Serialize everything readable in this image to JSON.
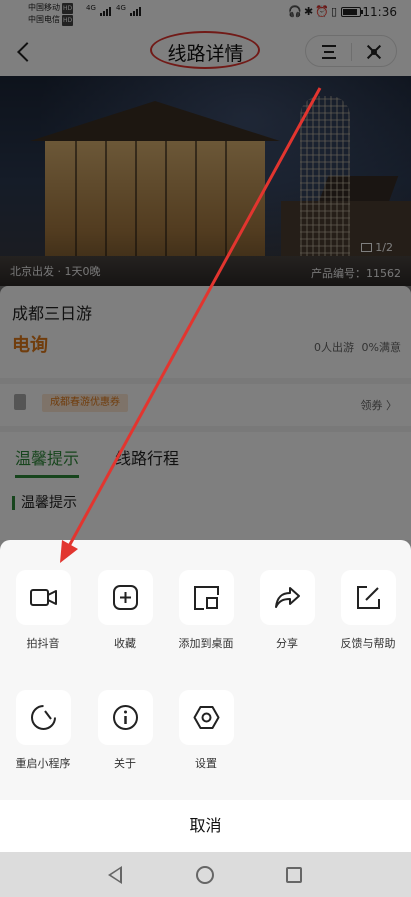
{
  "status_bar": {
    "carrier_1": "中国移动",
    "carrier_2": "中国电信",
    "hd_badge": "HD",
    "network_1": "4G",
    "network_2": "4G",
    "time": "11:36"
  },
  "navbar": {
    "title": "线路详情"
  },
  "hero": {
    "departure_info": "北京出发 · 1天0晚",
    "image_counter": "1/2",
    "product_code": "产品编号：11562"
  },
  "product": {
    "name": "成都三日游",
    "price": "电询",
    "stats": "0人出游 0%满意"
  },
  "coupon": {
    "tag": "成都春游优惠券",
    "get_label": "领券 〉"
  },
  "tabs": [
    {
      "label": "温馨提示"
    },
    {
      "label": "线路行程"
    }
  ],
  "section": {
    "title": "温馨提示"
  },
  "action_sheet": {
    "row1": [
      {
        "label": "拍抖音",
        "icon": "video-camera-icon"
      },
      {
        "label": "收藏",
        "icon": "add-favorite-icon"
      },
      {
        "label": "添加到桌面",
        "icon": "add-to-desktop-icon"
      },
      {
        "label": "分享",
        "icon": "share-icon"
      },
      {
        "label": "反馈与帮助",
        "icon": "feedback-icon"
      }
    ],
    "row2": [
      {
        "label": "重启小程序",
        "icon": "restart-icon"
      },
      {
        "label": "关于",
        "icon": "info-icon"
      },
      {
        "label": "设置",
        "icon": "settings-icon"
      }
    ],
    "cancel_label": "取消"
  },
  "colors": {
    "accent_green": "#2f8a3a",
    "price_orange": "#e07b1a",
    "annotation_red": "#e2352f"
  }
}
